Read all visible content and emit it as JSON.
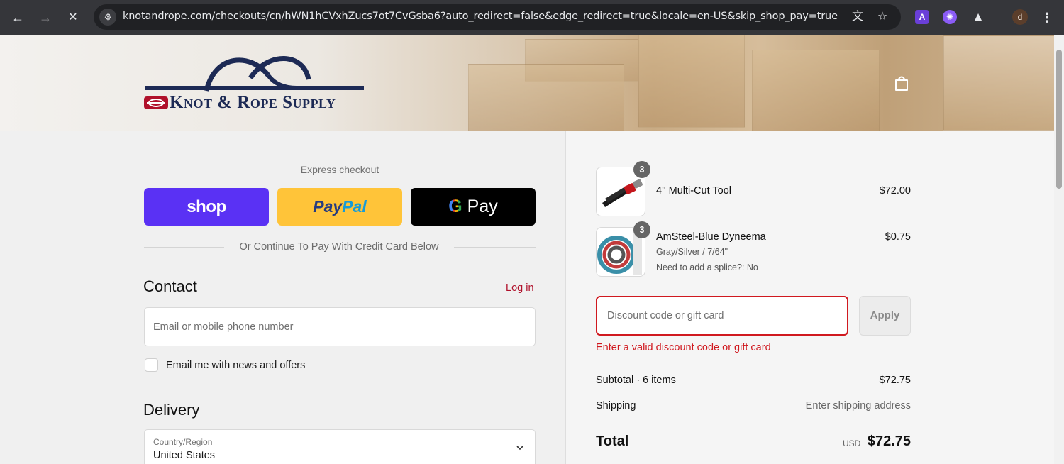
{
  "browser": {
    "url": "knotandrope.com/checkouts/cn/hWN1hCVxhZucs7ot7CvGsba6?auto_redirect=false&edge_redirect=true&locale=en-US&skip_shop_pay=true",
    "profile_initial": "d",
    "extension_a_label": "A"
  },
  "header": {
    "logo_text": "Knot & Rope Supply",
    "brand_colors": {
      "navy": "#1d2a55",
      "red": "#b0112b"
    }
  },
  "express": {
    "title": "Express checkout",
    "shop_label": "shop",
    "paypal_label_1": "Pay",
    "paypal_label_2": "Pal",
    "gpay_g": "G",
    "gpay_label": " Pay",
    "or_text": "Or Continue To Pay With Credit Card Below"
  },
  "contact": {
    "title": "Contact",
    "login_label": "Log in",
    "email_placeholder": "Email or mobile phone number",
    "newsletter_label": "Email me with news and offers"
  },
  "delivery": {
    "title": "Delivery",
    "country_label": "Country/Region",
    "country_value": "United States"
  },
  "cart": {
    "items": [
      {
        "qty": "3",
        "name": "4'' Multi-Cut Tool",
        "variant": "",
        "note": "",
        "price": "$72.00"
      },
      {
        "qty": "3",
        "name": "AmSteel-Blue Dyneema",
        "variant": "Gray/Silver / 7/64\"",
        "note": "Need to add a splice?: No",
        "price": "$0.75"
      }
    ],
    "discount_placeholder": "Discount code or gift card",
    "apply_label": "Apply",
    "discount_error": "Enter a valid discount code or gift card",
    "subtotal_label": "Subtotal · 6 items",
    "subtotal_value": "$72.75",
    "shipping_label": "Shipping",
    "shipping_value": "Enter shipping address",
    "total_label": "Total",
    "total_currency": "USD",
    "total_value": "$72.75"
  }
}
